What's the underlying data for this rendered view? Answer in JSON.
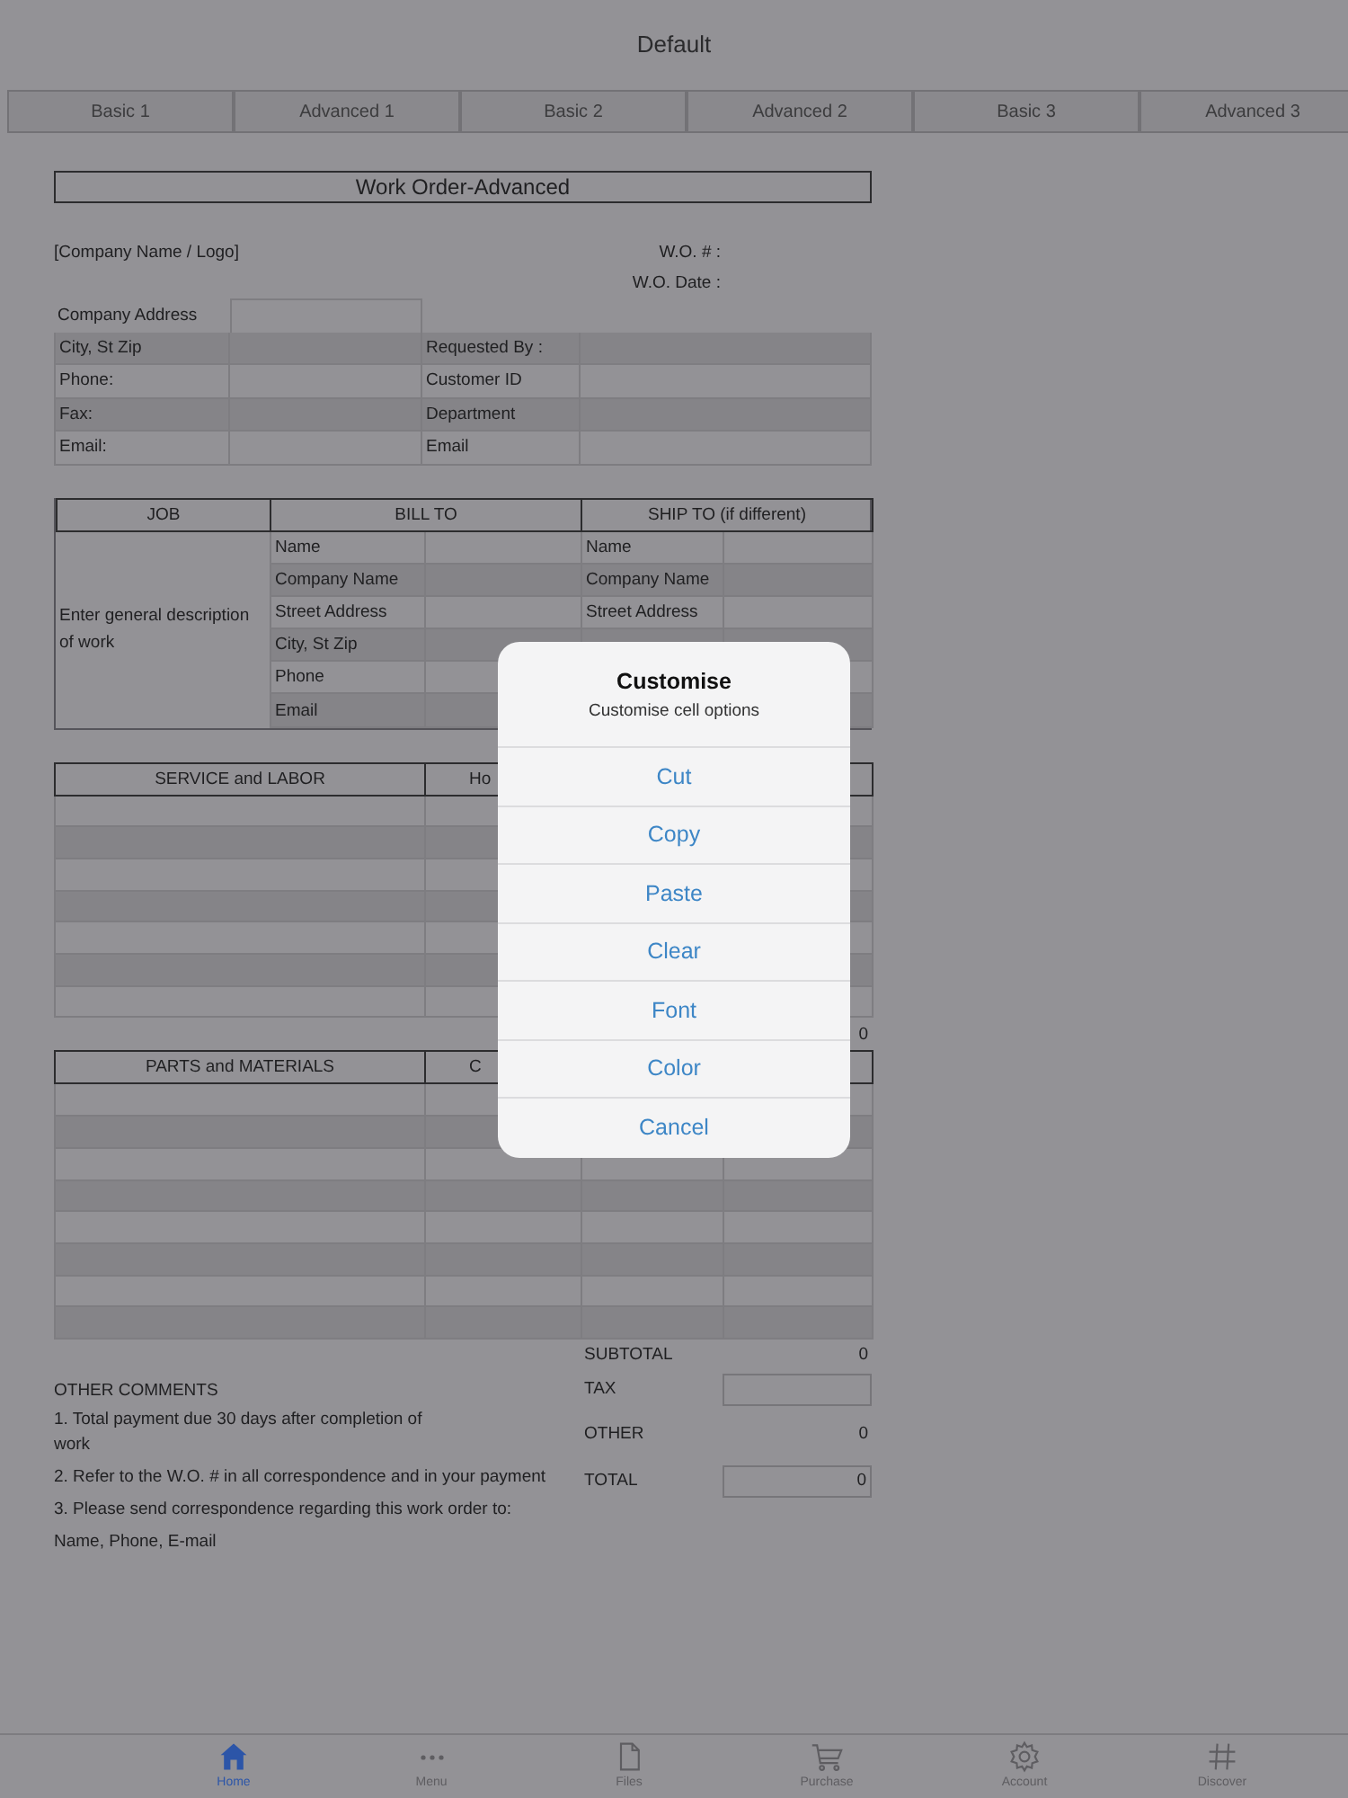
{
  "window": {
    "title": "Default"
  },
  "tabs": [
    {
      "label": "Basic 1",
      "selected": false
    },
    {
      "label": "Advanced 1",
      "selected": false
    },
    {
      "label": "Basic 2",
      "selected": false
    },
    {
      "label": "Advanced 2",
      "selected": false
    },
    {
      "label": "Basic 3",
      "selected": false
    },
    {
      "label": "Advanced 3",
      "selected": false
    }
  ],
  "form": {
    "title": "Work Order-Advanced",
    "company": "[Company Name / Logo]",
    "wo_number_label": "W.O. # :",
    "wo_date_label": "W.O. Date :",
    "address_label": "Company Address",
    "contact_rows": [
      {
        "label": "City, St Zip",
        "right_label": "Requested By :"
      },
      {
        "label": "Phone:",
        "right_label": "Customer ID"
      },
      {
        "label": "Fax:",
        "right_label": "Department"
      },
      {
        "label": "Email:",
        "right_label": "Email"
      }
    ],
    "job": {
      "headers": [
        "JOB",
        "BILL TO",
        "SHIP TO (if different)"
      ],
      "description": "Enter general description of work",
      "bill_to": [
        "Name",
        "Company Name",
        "Street Address",
        "City, St Zip",
        "Phone",
        "Email"
      ],
      "ship_to": [
        "Name",
        "Company Name",
        "Street Address"
      ]
    },
    "service": {
      "headers": [
        "SERVICE and LABOR",
        "Ho"
      ],
      "total": "0"
    },
    "parts": {
      "headers": [
        "PARTS and MATERIALS",
        "C"
      ]
    },
    "comments_title": "OTHER COMMENTS",
    "comments": [
      "1. Total payment due 30 days after completion of work",
      "2. Refer to the W.O. # in all correspondence and in your payment",
      "3. Please send correspondence regarding this work order to:",
      "Name, Phone, E-mail"
    ],
    "totals": [
      {
        "label": "SUBTOTAL",
        "value": "0",
        "kind": "plain"
      },
      {
        "label": "TAX",
        "kind": "box"
      },
      {
        "label": "OTHER",
        "value": "0",
        "kind": "plain"
      },
      {
        "label": "TOTAL",
        "value": "0",
        "kind": "box"
      }
    ]
  },
  "dialog": {
    "title": "Customise",
    "subtitle": "Customise cell options",
    "actions": [
      "Cut",
      "Copy",
      "Paste",
      "Clear",
      "Font",
      "Color",
      "Cancel"
    ]
  },
  "tab_bar": [
    {
      "label": "Home",
      "selected": true
    },
    {
      "label": "Menu",
      "selected": false
    },
    {
      "label": "Files",
      "selected": false
    },
    {
      "label": "Purchase",
      "selected": false
    },
    {
      "label": "Account",
      "selected": false
    },
    {
      "label": "Discover",
      "selected": false
    }
  ]
}
